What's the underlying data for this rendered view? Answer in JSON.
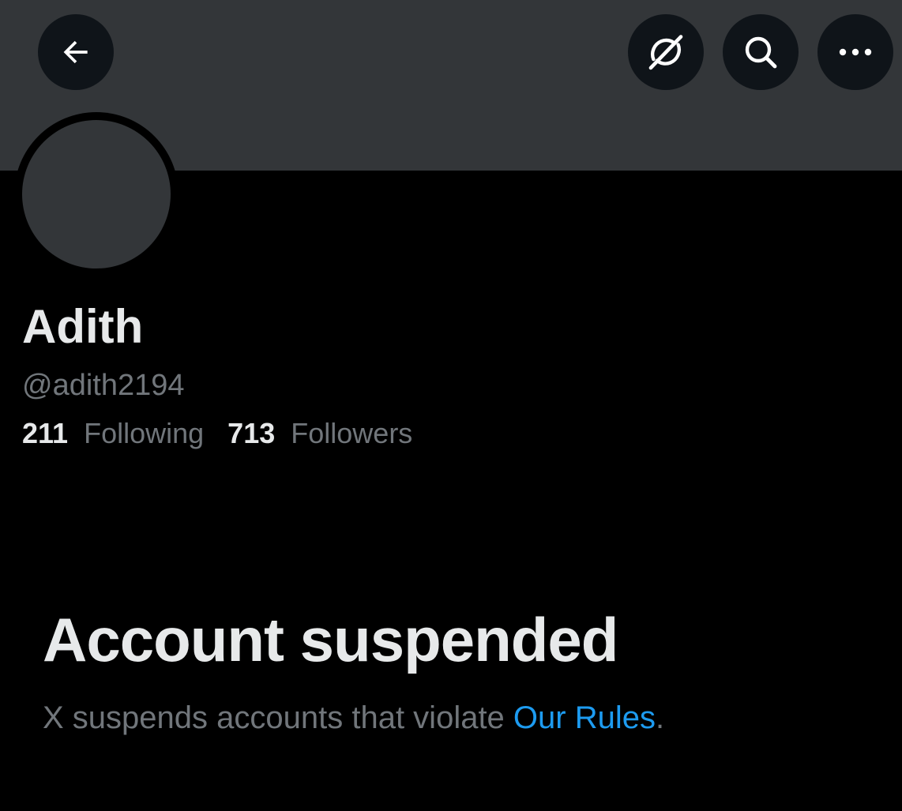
{
  "header": {
    "back_icon": "arrow-left-icon",
    "grok_icon": "grok-icon",
    "search_icon": "search-icon",
    "more_icon": "more-horizontal-icon"
  },
  "profile": {
    "display_name": "Adith",
    "handle": "@adith2194",
    "following_count": "211",
    "following_label": "Following",
    "followers_count": "713",
    "followers_label": "Followers"
  },
  "suspension": {
    "title": "Account suspended",
    "description_prefix": "X suspends accounts that violate ",
    "rules_link": "Our Rules",
    "description_suffix": "."
  },
  "colors": {
    "background": "#000000",
    "banner": "#333639",
    "button_bg": "#0f1419",
    "text_primary": "#e7e9ea",
    "text_secondary": "#71767b",
    "link": "#1d9bf0"
  }
}
